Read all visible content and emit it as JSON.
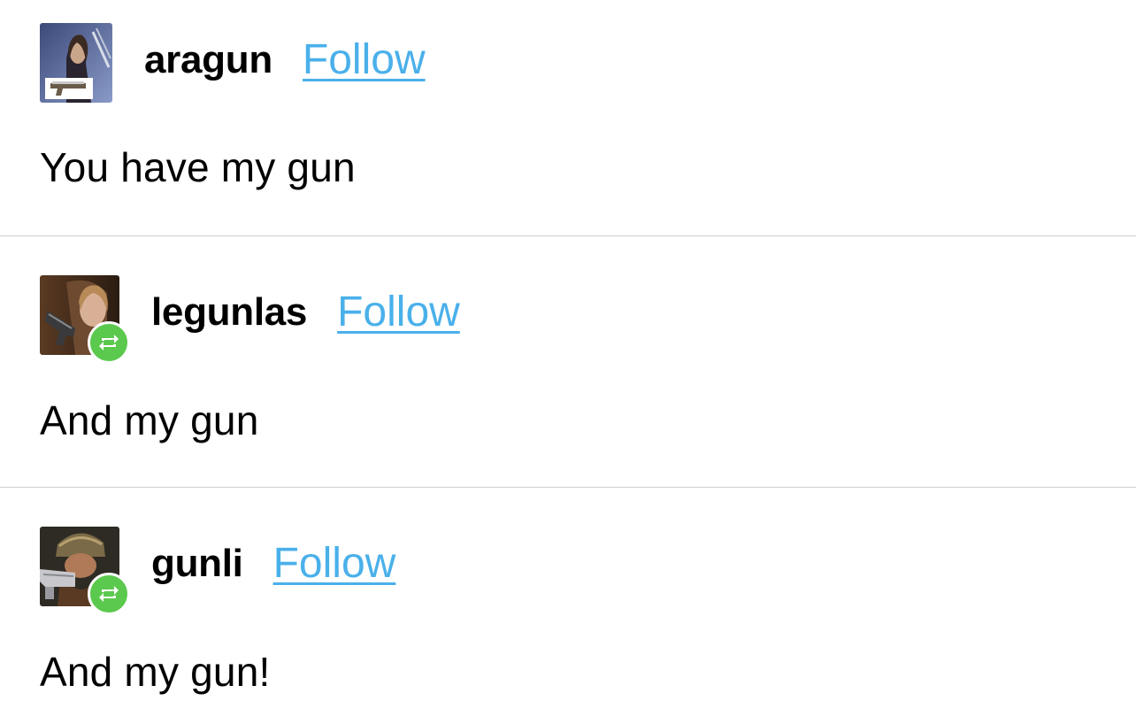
{
  "colors": {
    "follow": "#4ab0ea",
    "reblog_badge": "#5bc84e",
    "divider": "#cfcfcf"
  },
  "posts": [
    {
      "username": "aragun",
      "follow_label": "Follow",
      "text": "You have my gun",
      "reblog": false,
      "avatar_icon": "avatar-aragun"
    },
    {
      "username": "legunlas",
      "follow_label": "Follow",
      "text": "And my gun",
      "reblog": true,
      "avatar_icon": "avatar-legunlas"
    },
    {
      "username": "gunli",
      "follow_label": "Follow",
      "text": "And my gun!",
      "reblog": true,
      "avatar_icon": "avatar-gunli"
    }
  ]
}
